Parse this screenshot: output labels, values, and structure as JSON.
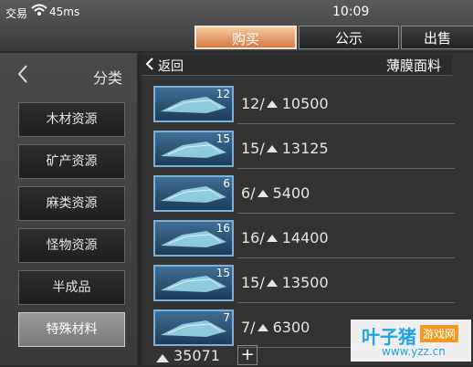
{
  "status": {
    "carrier": "交易",
    "signal": "45ms",
    "time": "10:09"
  },
  "tabs": [
    {
      "label": "购买",
      "active": true
    },
    {
      "label": "公示",
      "active": false
    },
    {
      "label": "出售",
      "active": false
    }
  ],
  "sidebar": {
    "back_icon": "chevron-left-icon",
    "title": "分类",
    "items": [
      {
        "label": "木材资源",
        "active": false
      },
      {
        "label": "矿产资源",
        "active": false
      },
      {
        "label": "麻类资源",
        "active": false
      },
      {
        "label": "怪物资源",
        "active": false
      },
      {
        "label": "半成品",
        "active": false
      },
      {
        "label": "特殊材料",
        "active": true
      }
    ]
  },
  "main": {
    "back_label": "返回",
    "category_title": "薄膜面料",
    "listings": [
      {
        "qty": "12",
        "price_text": "12/",
        "total": "10500"
      },
      {
        "qty": "15",
        "price_text": "15/",
        "total": "13125"
      },
      {
        "qty": "6",
        "price_text": "6/",
        "total": "5400"
      },
      {
        "qty": "16",
        "price_text": "16/",
        "total": "14400"
      },
      {
        "qty": "15",
        "price_text": "15/",
        "total": "13500"
      },
      {
        "qty": "7",
        "price_text": "7/",
        "total": "6300"
      }
    ]
  },
  "wallet": {
    "balance": "35071",
    "add_label": "+"
  },
  "watermark": {
    "title": "叶子猪",
    "sub1": "游戏网",
    "url": "www.yzz.cn"
  },
  "colors": {
    "accent": "#e4925f",
    "thumb_border": "#7db0d8",
    "watermark_blue": "#1ea3e6",
    "watermark_orange": "#f39a1e"
  }
}
